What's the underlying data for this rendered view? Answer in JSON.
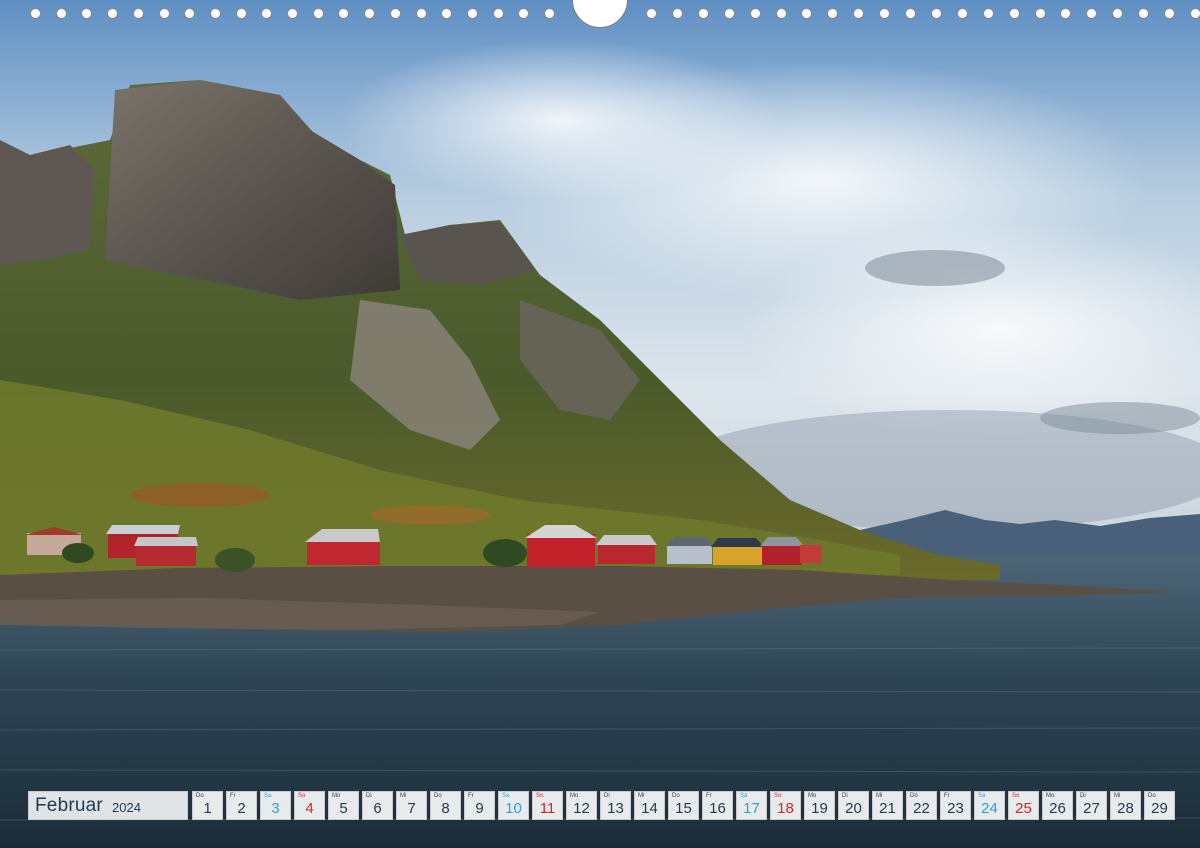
{
  "colors": {
    "weekday": "#243a50",
    "saturday": "#29a3d9",
    "sunday": "#d8202a"
  },
  "calendar": {
    "month": "Februar",
    "year": "2024",
    "days": [
      {
        "dow": "Do",
        "num": "1",
        "type": "weekday"
      },
      {
        "dow": "Fr",
        "num": "2",
        "type": "weekday"
      },
      {
        "dow": "Sa",
        "num": "3",
        "type": "sat"
      },
      {
        "dow": "So",
        "num": "4",
        "type": "sun"
      },
      {
        "dow": "Mo",
        "num": "5",
        "type": "weekday"
      },
      {
        "dow": "Di",
        "num": "6",
        "type": "weekday"
      },
      {
        "dow": "Mi",
        "num": "7",
        "type": "weekday"
      },
      {
        "dow": "Do",
        "num": "8",
        "type": "weekday"
      },
      {
        "dow": "Fr",
        "num": "9",
        "type": "weekday"
      },
      {
        "dow": "Sa",
        "num": "10",
        "type": "sat"
      },
      {
        "dow": "So",
        "num": "11",
        "type": "sun"
      },
      {
        "dow": "Mo",
        "num": "12",
        "type": "weekday"
      },
      {
        "dow": "Di",
        "num": "13",
        "type": "weekday"
      },
      {
        "dow": "Mi",
        "num": "14",
        "type": "weekday"
      },
      {
        "dow": "Do",
        "num": "15",
        "type": "weekday"
      },
      {
        "dow": "Fr",
        "num": "16",
        "type": "weekday"
      },
      {
        "dow": "Sa",
        "num": "17",
        "type": "sat"
      },
      {
        "dow": "So",
        "num": "18",
        "type": "sun"
      },
      {
        "dow": "Mo",
        "num": "19",
        "type": "weekday"
      },
      {
        "dow": "Di",
        "num": "20",
        "type": "weekday"
      },
      {
        "dow": "Mi",
        "num": "21",
        "type": "weekday"
      },
      {
        "dow": "Do",
        "num": "22",
        "type": "weekday"
      },
      {
        "dow": "Fr",
        "num": "23",
        "type": "weekday"
      },
      {
        "dow": "Sa",
        "num": "24",
        "type": "sat"
      },
      {
        "dow": "So",
        "num": "25",
        "type": "sun"
      },
      {
        "dow": "Mo",
        "num": "26",
        "type": "weekday"
      },
      {
        "dow": "Di",
        "num": "27",
        "type": "weekday"
      },
      {
        "dow": "Mi",
        "num": "28",
        "type": "weekday"
      },
      {
        "dow": "Do",
        "num": "29",
        "type": "weekday"
      }
    ]
  }
}
